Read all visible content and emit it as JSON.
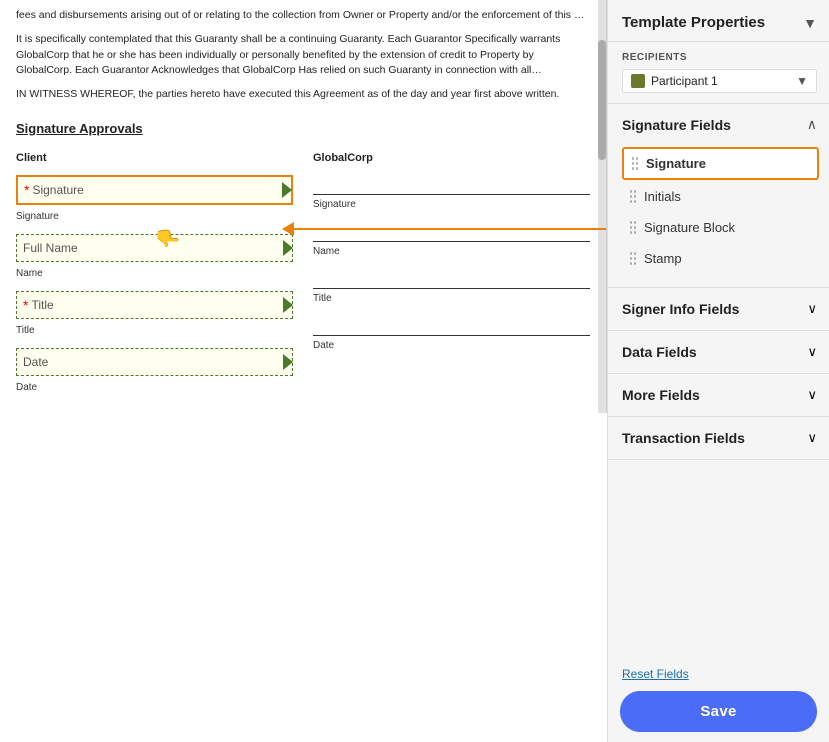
{
  "panel": {
    "title": "Template Properties",
    "collapse_icon": "▼"
  },
  "recipients": {
    "label": "RECIPIENTS",
    "participant": {
      "name": "Participant 1",
      "chevron": "▼",
      "color": "#6a7a2a"
    }
  },
  "signature_fields": {
    "label": "Signature Fields",
    "chevron_expanded": "∧",
    "items": [
      {
        "label": "Signature",
        "active": true
      },
      {
        "label": "Initials",
        "active": false
      },
      {
        "label": "Signature Block",
        "active": false
      },
      {
        "label": "Stamp",
        "active": false
      }
    ]
  },
  "signer_info": {
    "label": "Signer Info Fields",
    "chevron": "∨"
  },
  "data_fields": {
    "label": "Data Fields",
    "chevron": "∨"
  },
  "more_fields": {
    "label": "More Fields",
    "chevron": "∨"
  },
  "transaction_fields": {
    "label": "Transaction Fields",
    "chevron": "∨"
  },
  "bottom": {
    "reset_label": "Reset Fields",
    "save_label": "Save"
  },
  "doc": {
    "body_text_1": "fees and disbursements arising out of or relating to the collection from Owner or Property and/or the enforcement of this Guaranty.",
    "body_text_2": "It is specifically contemplated that this Guaranty shall be a continuing Guaranty. Each Guarantor Specifically warrants GlobalCorp that he or she has been individually or personally benefited by the extension of credit to Property by GlobalCorp. Each Guarantor Acknowledges that GlobalCorp Has relied on such Guaranty in connection with all extension(s) of credit to the Property.",
    "body_text_3": "IN WITNESS WHEREOF, the parties hereto have executed this Agreement as of the day and year first above written.",
    "section_title": "Signature Approvals",
    "client_label": "Client",
    "globalcorp_label": "GlobalCorp",
    "sig_placeholder": "Signature",
    "fields": {
      "client": [
        {
          "label": "Signature",
          "placeholder": "Signature",
          "highlighted": true,
          "required": true,
          "has_chevron": true
        },
        {
          "label": "Full Name",
          "placeholder": "Full Name",
          "highlighted": false,
          "required": false,
          "has_chevron": true
        },
        {
          "label": "Title",
          "placeholder": "Title",
          "highlighted": false,
          "required": true,
          "has_chevron": true
        },
        {
          "label": "Date",
          "placeholder": "Date",
          "highlighted": false,
          "required": false,
          "has_chevron": true
        }
      ],
      "labels_client": [
        "Signature",
        "Name",
        "Title",
        "Date"
      ],
      "globalcorp": [
        "Signature",
        "Name",
        "Title",
        "Date"
      ]
    }
  }
}
